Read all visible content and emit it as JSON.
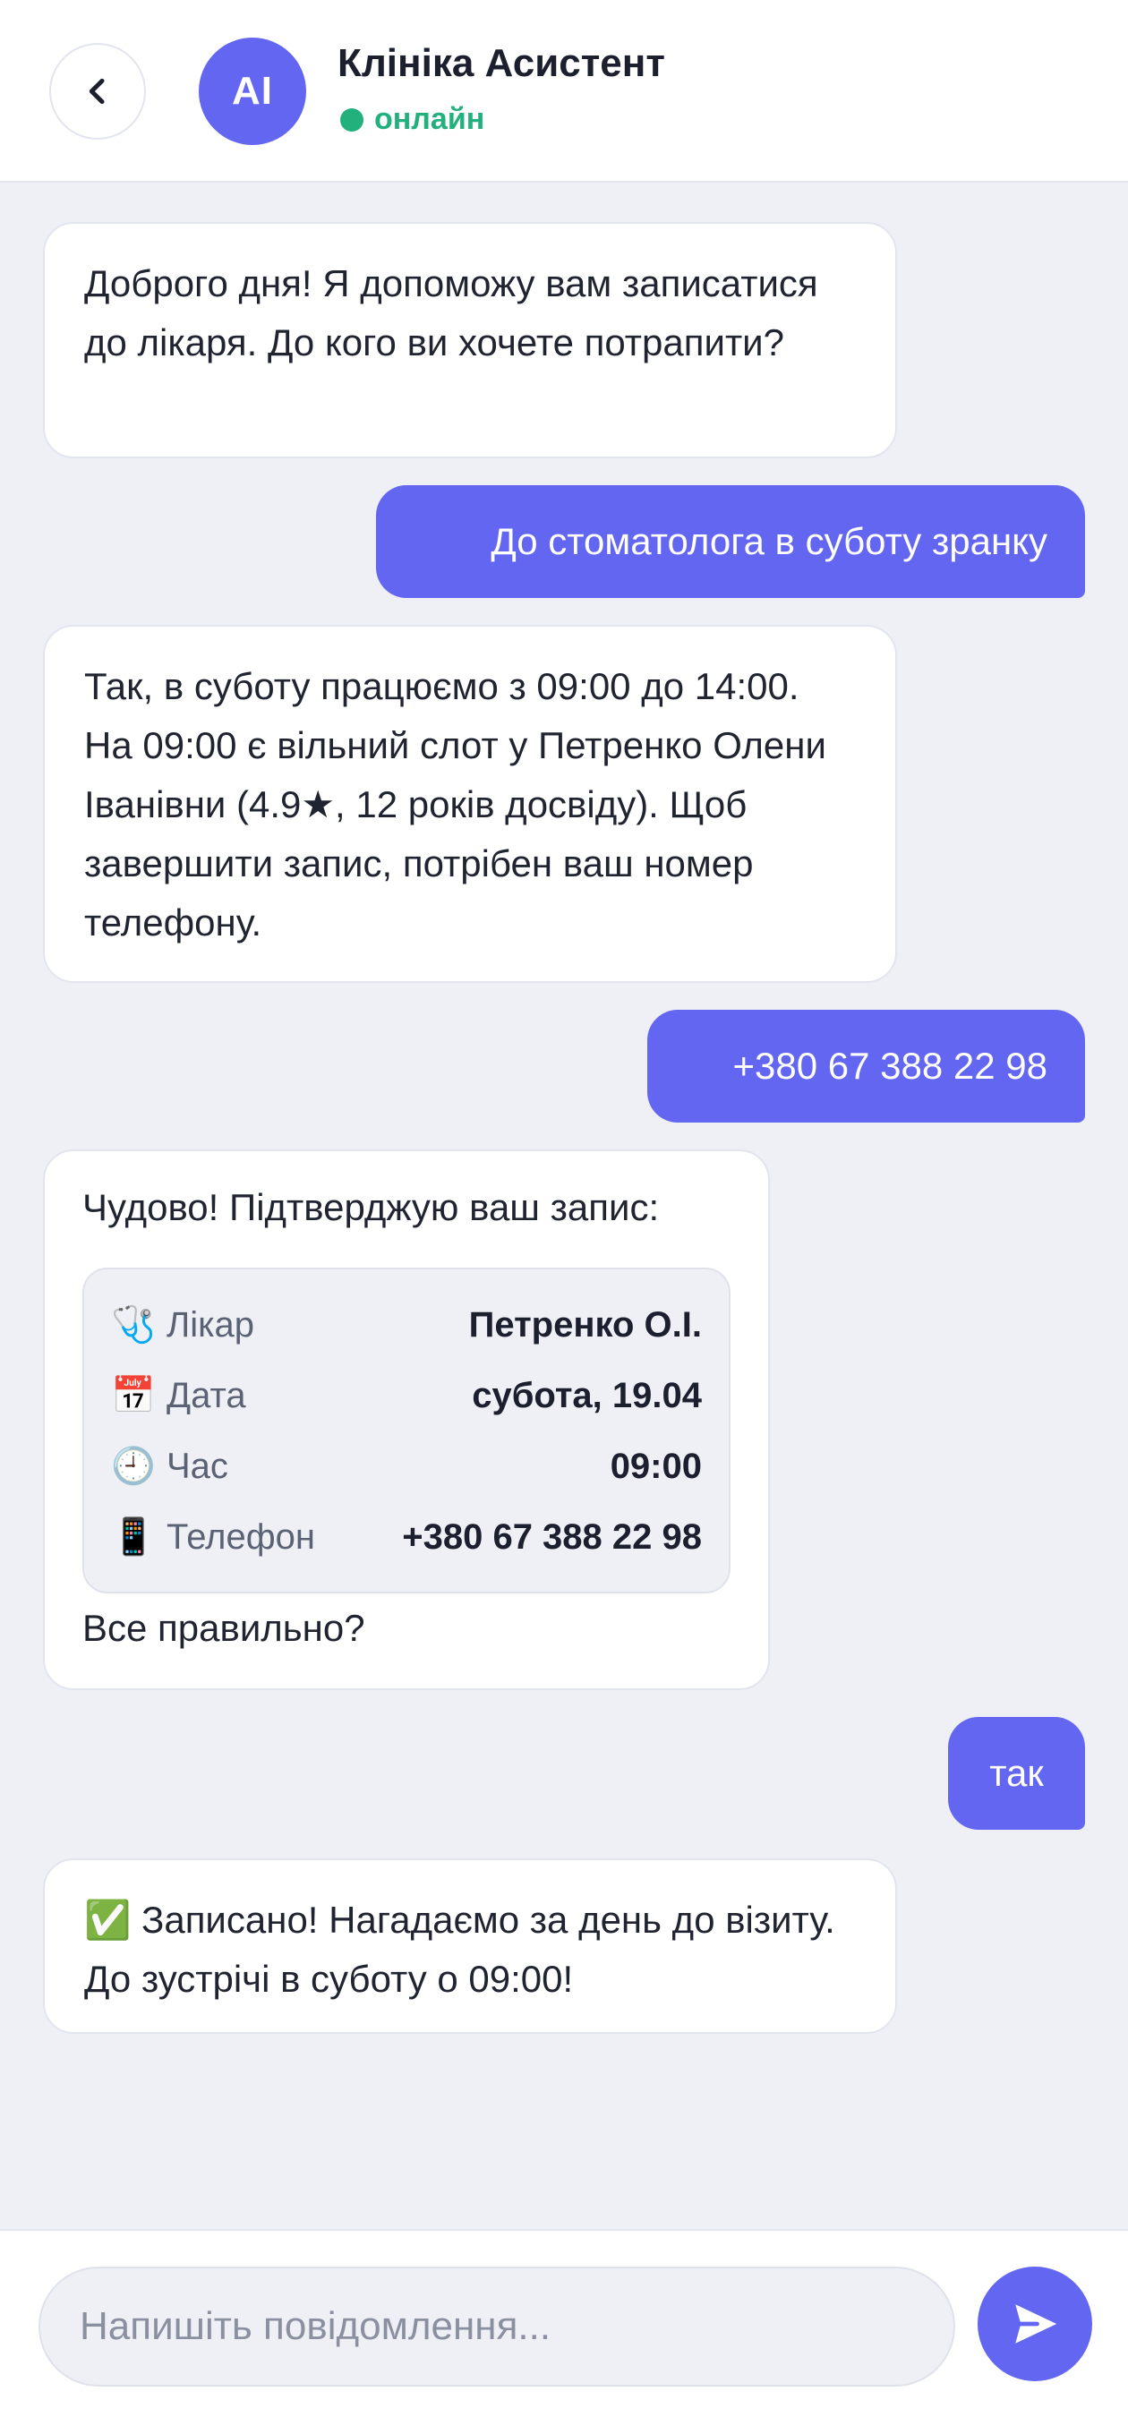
{
  "header": {
    "avatar_text": "AI",
    "title": "Клініка Асистент",
    "status": "онлайн",
    "back_icon": "chevron-left-icon"
  },
  "messages": [
    {
      "from": "bot",
      "text": "Доброго дня! Я допоможу вам записатися до лікаря. До кого ви хочете потрапити?"
    },
    {
      "from": "user",
      "text": "До стоматолога в суботу зранку"
    },
    {
      "from": "bot",
      "text": "Так, в суботу працюємо з 09:00 до 14:00. На 09:00 є вільний слот у Петренко Олени Іванівни (4.9★, 12 років досвіду). Щоб завершити запис, потрібен ваш номер телефону."
    },
    {
      "from": "user",
      "text": "+380 67 388 22 98"
    },
    {
      "from": "bot",
      "intro": "Чудово! Підтверджую ваш запис:",
      "card": [
        {
          "icon": "🩺",
          "icon_name": "stethoscope-icon",
          "label": "Лікар",
          "value": "Петренко О.І."
        },
        {
          "icon": "📅",
          "icon_name": "calendar-icon",
          "label": "Дата",
          "value": "субота, 19.04"
        },
        {
          "icon": "🕘",
          "icon_name": "clock-icon",
          "label": "Час",
          "value": "09:00"
        },
        {
          "icon": "📱",
          "icon_name": "phone-icon",
          "label": "Телефон",
          "value": "+380 67 388 22 98"
        }
      ],
      "outro": "Все правильно?"
    },
    {
      "from": "user",
      "text": "так"
    },
    {
      "from": "bot",
      "text": "✅ Записано! Нагадаємо за день до візиту. До зустрічі в суботу о 09:00!"
    }
  ],
  "composer": {
    "placeholder": "Напишіть повідомлення...",
    "value": "",
    "send_icon": "send-icon"
  },
  "colors": {
    "accent": "#6366f1",
    "online": "#22b07d",
    "background": "#eef0f6"
  }
}
